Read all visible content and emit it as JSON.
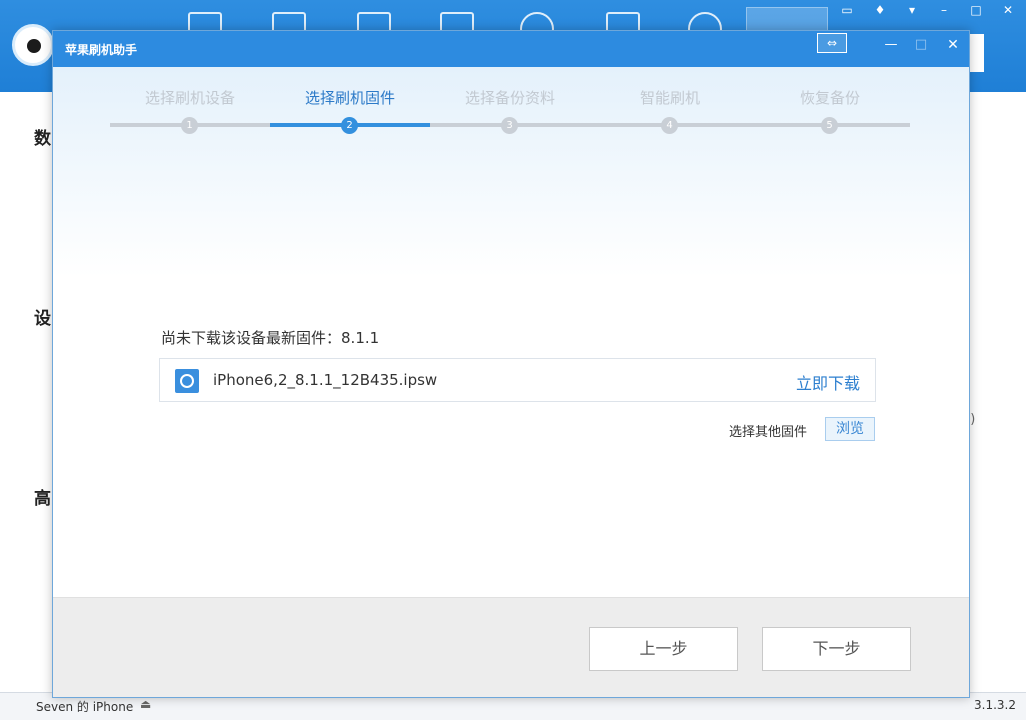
{
  "background": {
    "sections": [
      "数",
      "设",
      "高"
    ],
    "side_text": "S)",
    "status": {
      "device": "Seven 的 iPhone",
      "version": "3.1.3.2"
    }
  },
  "dialog": {
    "title": "苹果刷机助手",
    "controls": {
      "expand": "⇔",
      "minimize": "—",
      "maximize": "□",
      "close": "✕"
    },
    "steps": [
      {
        "label": "选择刷机设备",
        "number": "1",
        "active": false
      },
      {
        "label": "选择刷机固件",
        "number": "2",
        "active": true
      },
      {
        "label": "选择备份资料",
        "number": "3",
        "active": false
      },
      {
        "label": "智能刷机",
        "number": "4",
        "active": false
      },
      {
        "label": "恢复备份",
        "number": "5",
        "active": false
      }
    ],
    "firmware_prompt": "尚未下载该设备最新固件：8.1.1",
    "firmware_name": "iPhone6,2_8.1.1_12B435.ipsw",
    "download_label": "立即下载",
    "other_firmware_label": "选择其他固件",
    "browse_label": "浏览",
    "prev_label": "上一步",
    "next_label": "下一步"
  }
}
